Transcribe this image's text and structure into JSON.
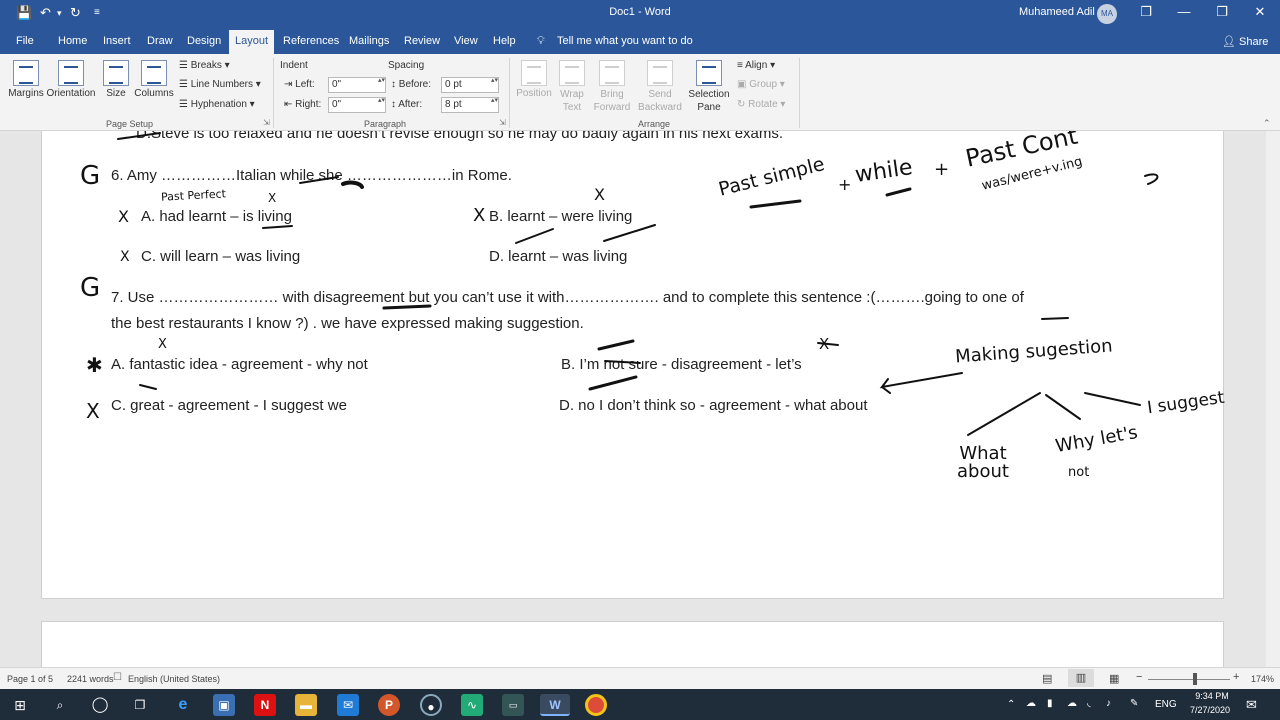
{
  "window": {
    "title": "Doc1 - Word",
    "user_name": "Muhameed Adil",
    "user_initials": "MA"
  },
  "quick_access": {
    "save": "💾",
    "undo": "↶",
    "undo_arrow": "▾",
    "redo": "↻",
    "customize": "≡"
  },
  "window_controls": {
    "ribbon_display": "❐",
    "minimize": "—",
    "restore": "❐",
    "close": "✕"
  },
  "tabs": [
    {
      "label": "File"
    },
    {
      "label": "Home"
    },
    {
      "label": "Insert"
    },
    {
      "label": "Draw"
    },
    {
      "label": "Design"
    },
    {
      "label": "Layout"
    },
    {
      "label": "References"
    },
    {
      "label": "Mailings"
    },
    {
      "label": "Review"
    },
    {
      "label": "View"
    },
    {
      "label": "Help"
    }
  ],
  "tell_me": "Tell me what you want to do",
  "share": "Share",
  "ribbon": {
    "page_setup": {
      "margins": "Margins",
      "orientation": "Orientation",
      "size": "Size",
      "columns": "Columns",
      "breaks": "Breaks",
      "line_numbers": "Line Numbers",
      "hyphenation": "Hyphenation",
      "label": "Page Setup"
    },
    "paragraph": {
      "indent_label": "Indent",
      "left_label": "Left:",
      "left_value": "0\"",
      "right_label": "Right:",
      "right_value": "0\"",
      "spacing_label": "Spacing",
      "before_label": "Before:",
      "before_value": "0 pt",
      "after_label": "After:",
      "after_value": "8 pt",
      "label": "Paragraph"
    },
    "arrange": {
      "position": "Position",
      "wrap_text": "Wrap Text",
      "bring_forward": "Bring Forward",
      "send_backward": "Send Backward",
      "selection_pane": "Selection Pane",
      "align": "Align",
      "group": "Group",
      "rotate": "Rotate",
      "label": "Arrange"
    }
  },
  "document": {
    "line_d_steve": "D.Steve is too relaxed and he doesn’t revise enough so he  may do badly again in his next exams.",
    "q6": {
      "stem": "6.  Amy ……………Italian while she …………………in Rome.",
      "a": "A. had learnt – is living",
      "b": "B. learnt – were living",
      "c": "C. will learn – was living",
      "d": "D. learnt – was living"
    },
    "q7": {
      "stem_line1": "7.  Use …………………… with disagreement but you can’t use it with………………. and to complete this sentence :(……….going to one of",
      "stem_line2": "the best restaurants I know ?) . we have expressed making suggestion.",
      "a": "A. fantastic idea -  agreement -  why not",
      "b": "B. I’m not sure - disagreement -  let’s",
      "c": "C. great -  agreement - I suggest we",
      "d": "D. no I don’t think so -  agreement -  what about"
    }
  },
  "handwriting": {
    "g6": "G",
    "g7": "G",
    "past_perfect": "Past Perfect",
    "past_simple": "Past simple",
    "while": "while",
    "plus1": "+",
    "plus2": "+",
    "past_cont": "Past Cont",
    "was_were_ing": "was/were+v.ing",
    "making_suggestion": "Making sugestion",
    "what_about": "What about",
    "why_lets_not": "Why let's",
    "not": "not",
    "i_suggest": "I suggest",
    "x_mark": "X",
    "star_mark": "✱"
  },
  "status": {
    "page": "Page 1 of 5",
    "words": "2241 words",
    "language": "English (United States)",
    "zoom": "174%",
    "zoom_level_percent": 174
  },
  "taskbar": {
    "language": "ENG",
    "time": "9:34 PM",
    "date": "7/27/2020"
  },
  "colors": {
    "word_blue": "#2b579a",
    "taskbar": "#1f2c3a",
    "ink": "#111111"
  }
}
